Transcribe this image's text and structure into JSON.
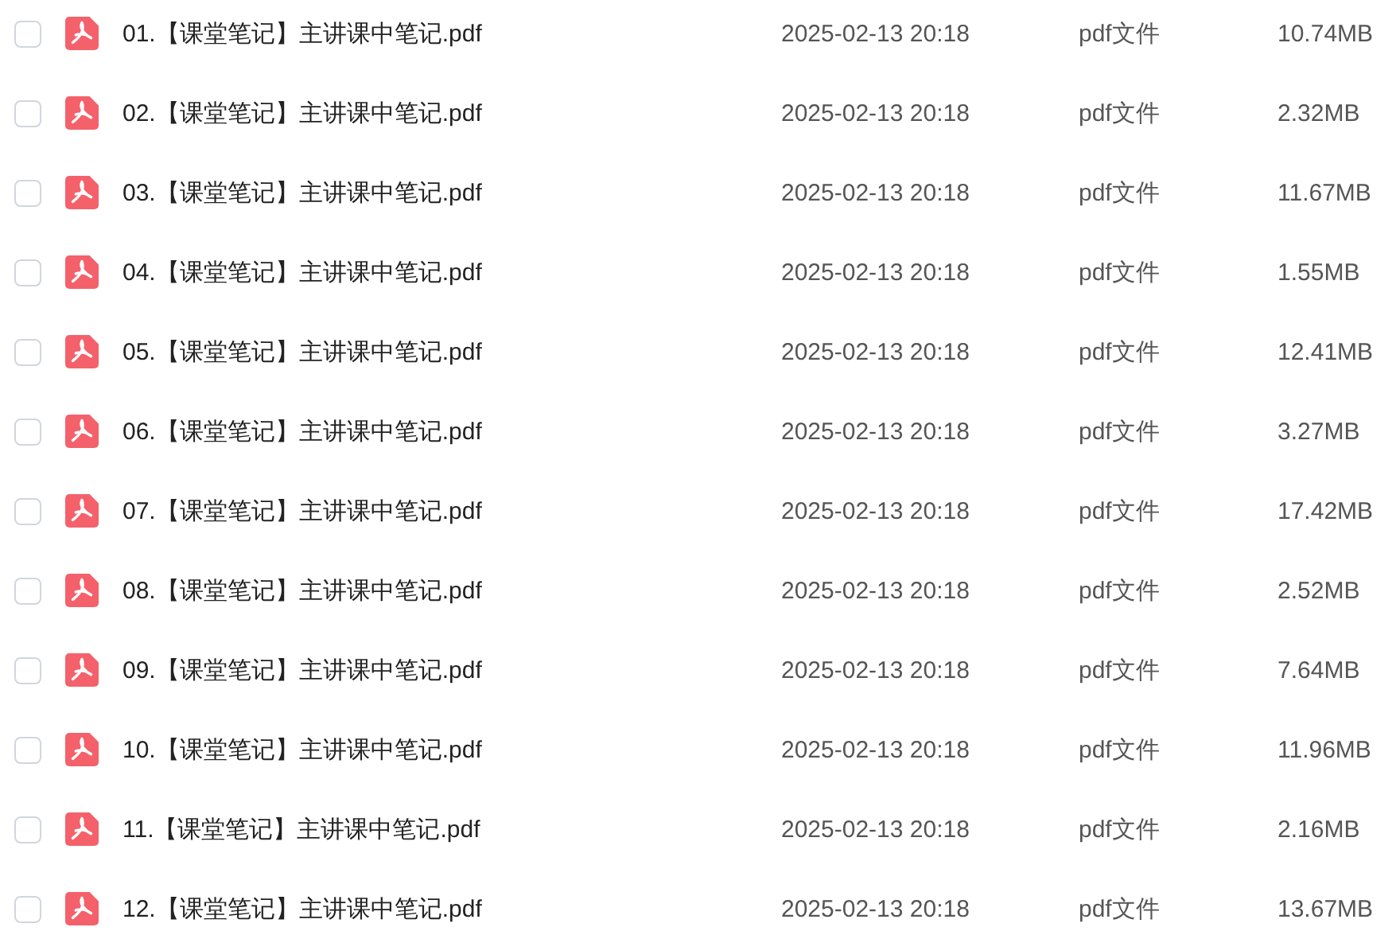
{
  "files": [
    {
      "name": "01.【课堂笔记】主讲课中笔记.pdf",
      "modified": "2025-02-13 20:18",
      "type": "pdf文件",
      "size": "10.74MB",
      "checked": false
    },
    {
      "name": "02.【课堂笔记】主讲课中笔记.pdf",
      "modified": "2025-02-13 20:18",
      "type": "pdf文件",
      "size": "2.32MB",
      "checked": false
    },
    {
      "name": "03.【课堂笔记】主讲课中笔记.pdf",
      "modified": "2025-02-13 20:18",
      "type": "pdf文件",
      "size": "11.67MB",
      "checked": false
    },
    {
      "name": "04.【课堂笔记】主讲课中笔记.pdf",
      "modified": "2025-02-13 20:18",
      "type": "pdf文件",
      "size": "1.55MB",
      "checked": false
    },
    {
      "name": "05.【课堂笔记】主讲课中笔记.pdf",
      "modified": "2025-02-13 20:18",
      "type": "pdf文件",
      "size": "12.41MB",
      "checked": false
    },
    {
      "name": "06.【课堂笔记】主讲课中笔记.pdf",
      "modified": "2025-02-13 20:18",
      "type": "pdf文件",
      "size": "3.27MB",
      "checked": false
    },
    {
      "name": "07.【课堂笔记】主讲课中笔记.pdf",
      "modified": "2025-02-13 20:18",
      "type": "pdf文件",
      "size": "17.42MB",
      "checked": false
    },
    {
      "name": "08.【课堂笔记】主讲课中笔记.pdf",
      "modified": "2025-02-13 20:18",
      "type": "pdf文件",
      "size": "2.52MB",
      "checked": false
    },
    {
      "name": "09.【课堂笔记】主讲课中笔记.pdf",
      "modified": "2025-02-13 20:18",
      "type": "pdf文件",
      "size": "7.64MB",
      "checked": false
    },
    {
      "name": "10.【课堂笔记】主讲课中笔记.pdf",
      "modified": "2025-02-13 20:18",
      "type": "pdf文件",
      "size": "11.96MB",
      "checked": false
    },
    {
      "name": "11.【课堂笔记】主讲课中笔记.pdf",
      "modified": "2025-02-13 20:18",
      "type": "pdf文件",
      "size": "2.16MB",
      "checked": false
    },
    {
      "name": "12.【课堂笔记】主讲课中笔记.pdf",
      "modified": "2025-02-13 20:18",
      "type": "pdf文件",
      "size": "13.67MB",
      "checked": false
    }
  ]
}
